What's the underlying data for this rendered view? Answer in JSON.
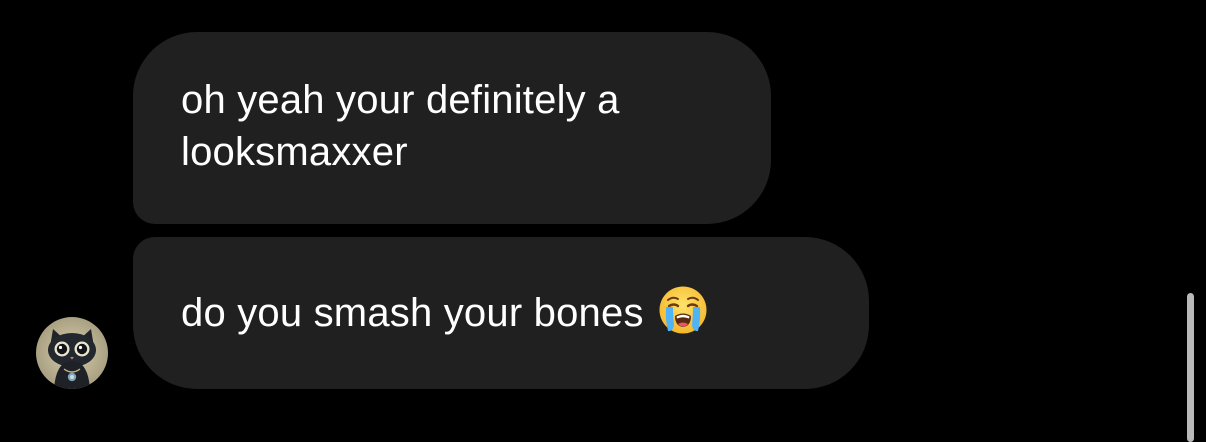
{
  "messages": [
    {
      "text": "oh yeah your definitely a looksmaxxer"
    },
    {
      "text": "do you smash your bones",
      "emoji": "loudly-crying-face-icon"
    }
  ],
  "avatar": {
    "icon": "black-cat-avatar-icon"
  },
  "colors": {
    "background": "#000000",
    "bubble": "#202020",
    "text": "#ffffff",
    "scrollbar": "#b9b9b9"
  }
}
